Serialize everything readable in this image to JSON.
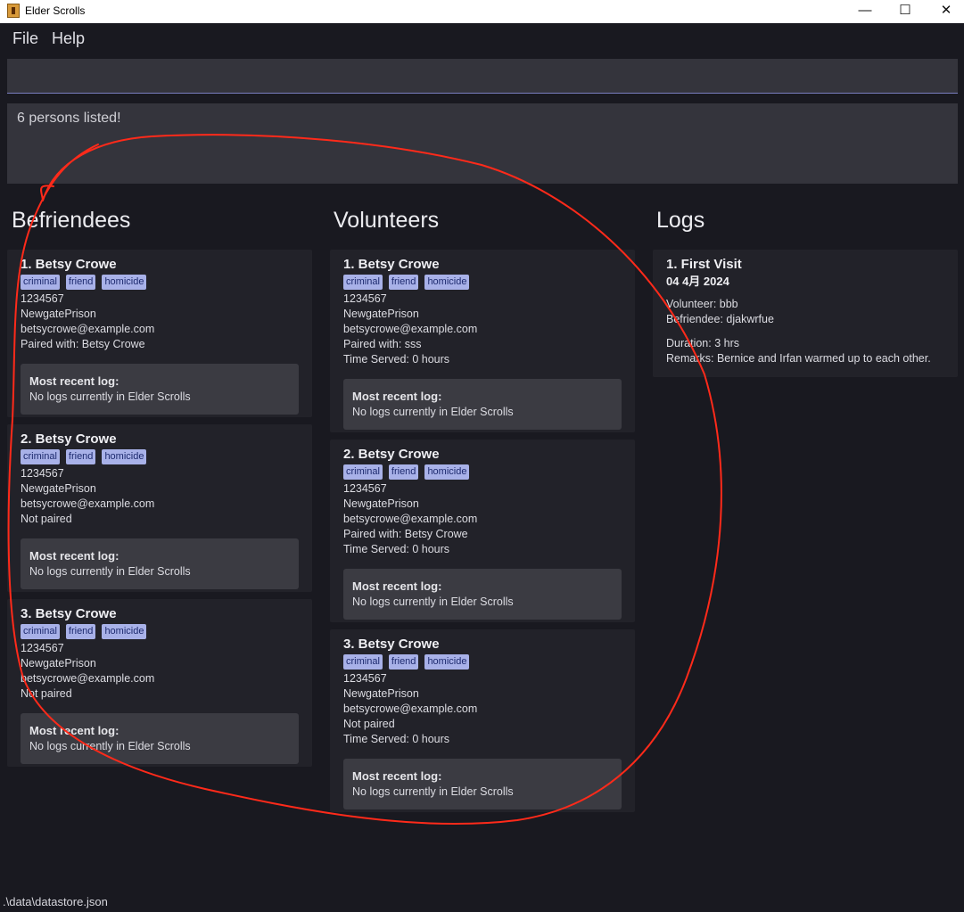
{
  "window": {
    "title": "Elder Scrolls",
    "minimize": "—",
    "maximize": "☐",
    "close": "✕"
  },
  "menu": {
    "file": "File",
    "help": "Help"
  },
  "command": {
    "value": ""
  },
  "result": {
    "message": "6 persons listed!"
  },
  "befriendees": {
    "title": "Befriendees",
    "items": [
      {
        "name": "1.  Betsy Crowe",
        "tags": [
          "criminal",
          "friend",
          "homicide"
        ],
        "phone": "1234567",
        "address": "NewgatePrison",
        "email": "betsycrowe@example.com",
        "pair": "Paired with: Betsy Crowe",
        "log_title": "Most recent log:",
        "log_text": "No logs currently in Elder Scrolls"
      },
      {
        "name": "2.  Betsy Crowe",
        "tags": [
          "criminal",
          "friend",
          "homicide"
        ],
        "phone": "1234567",
        "address": "NewgatePrison",
        "email": "betsycrowe@example.com",
        "pair": "Not paired",
        "log_title": "Most recent log:",
        "log_text": "No logs currently in Elder Scrolls"
      },
      {
        "name": "3.  Betsy Crowe",
        "tags": [
          "criminal",
          "friend",
          "homicide"
        ],
        "phone": "1234567",
        "address": "NewgatePrison",
        "email": "betsycrowe@example.com",
        "pair": "Not paired",
        "log_title": "Most recent log:",
        "log_text": "No logs currently in Elder Scrolls"
      }
    ]
  },
  "volunteers": {
    "title": "Volunteers",
    "items": [
      {
        "name": "1.  Betsy Crowe",
        "tags": [
          "criminal",
          "friend",
          "homicide"
        ],
        "phone": "1234567",
        "address": "NewgatePrison",
        "email": "betsycrowe@example.com",
        "pair": "Paired with: sss",
        "time": "Time Served: 0 hours",
        "log_title": "Most recent log:",
        "log_text": "No logs currently in Elder Scrolls"
      },
      {
        "name": "2.  Betsy Crowe",
        "tags": [
          "criminal",
          "friend",
          "homicide"
        ],
        "phone": "1234567",
        "address": "NewgatePrison",
        "email": "betsycrowe@example.com",
        "pair": "Paired with: Betsy Crowe",
        "time": "Time Served: 0 hours",
        "log_title": "Most recent log:",
        "log_text": "No logs currently in Elder Scrolls"
      },
      {
        "name": "3.  Betsy Crowe",
        "tags": [
          "criminal",
          "friend",
          "homicide"
        ],
        "phone": "1234567",
        "address": "NewgatePrison",
        "email": "betsycrowe@example.com",
        "pair": "Not paired",
        "time": "Time Served: 0 hours",
        "log_title": "Most recent log:",
        "log_text": "No logs currently in Elder Scrolls"
      }
    ]
  },
  "logs": {
    "title": "Logs",
    "items": [
      {
        "title": "1.  First Visit",
        "date": "04 4月 2024",
        "volunteer": "Volunteer: bbb",
        "befriendee": "Befriendee: djakwrfue",
        "duration": "Duration: 3 hrs",
        "remarks": "Remarks: Bernice and Irfan warmed up to each other."
      }
    ]
  },
  "footer": {
    "path": ".\\data\\datastore.json"
  },
  "colors": {
    "background": "#191920",
    "card": "#222229",
    "tag": "#a8b1e8",
    "annotation": "#ff2a1a"
  }
}
